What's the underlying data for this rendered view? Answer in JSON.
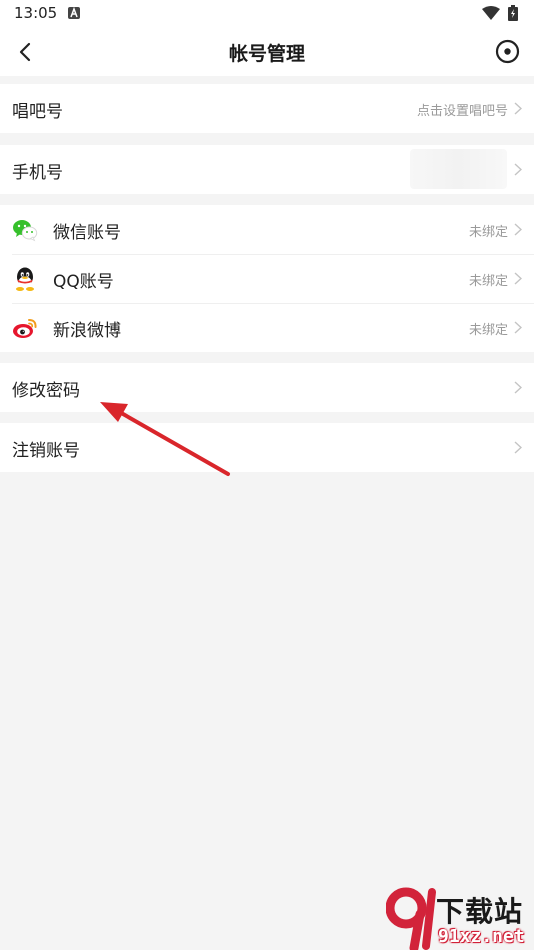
{
  "status_bar": {
    "time": "13:05"
  },
  "nav": {
    "title": "帐号管理"
  },
  "rows": {
    "changba_id": {
      "label": "唱吧号",
      "value": "点击设置唱吧号"
    },
    "phone": {
      "label": "手机号"
    },
    "wechat": {
      "label": "微信账号",
      "value": "未绑定",
      "icon": "wechat-icon"
    },
    "qq": {
      "label": "QQ账号",
      "value": "未绑定",
      "icon": "qq-icon"
    },
    "weibo": {
      "label": "新浪微博",
      "value": "未绑定",
      "icon": "weibo-icon"
    },
    "change_password": {
      "label": "修改密码"
    },
    "delete_account": {
      "label": "注销账号"
    }
  },
  "colors": {
    "background": "#f4f4f4",
    "annotation_arrow": "#d9262b",
    "wechat": "#36c02c",
    "weibo": "#e6162d"
  },
  "watermark": {
    "title": "下载站",
    "url": "91xz.net"
  }
}
